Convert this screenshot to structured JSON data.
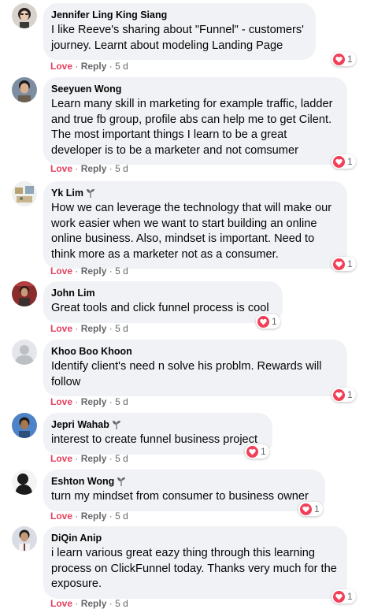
{
  "colors": {
    "love": "#e4405f",
    "bubble": "#f0f2f5",
    "meta": "#65676b"
  },
  "comments": [
    {
      "name": "Jennifer Ling King Siang",
      "text": "I like Reeve's sharing about \"Funnel\" - customers' journey. Learnt about modeling Landing Page",
      "love": "Love",
      "reply": "Reply",
      "time": "5 d",
      "reactions": "1"
    },
    {
      "name": "Seeyuen Wong",
      "text": "Learn many skill in marketing for example traffic, ladder and true fb group, profile abs can help me to get Cilent. The most important things I learn to be a great developer is to be a marketer and not comsumer",
      "love": "Love",
      "reply": "Reply",
      "time": "5 d",
      "reactions": "1"
    },
    {
      "name": "Yk Lim",
      "text": "How we can leverage the technology that will make our work easier when we want to start building an online online business. Also, mindset is important. Need to think more as a marketer not as a consumer.",
      "love": "Love",
      "reply": "Reply",
      "time": "5 d",
      "reactions": "1"
    },
    {
      "name": "John Lim",
      "text": "Great tools and click funnel process is cool",
      "love": "Love",
      "reply": "Reply",
      "time": "5 d",
      "reactions": "1"
    },
    {
      "name": "Khoo Boo Khoon",
      "text": "Identify client's need n solve his problm. Rewards will follow",
      "love": "Love",
      "reply": "Reply",
      "time": "5 d",
      "reactions": "1"
    },
    {
      "name": "Jepri Wahab",
      "text": "interest to create funnel business project",
      "love": "Love",
      "reply": "Reply",
      "time": "5 d",
      "reactions": "1"
    },
    {
      "name": "Eshton Wong",
      "text": "turn my mindset from consumer to business owner",
      "love": "Love",
      "reply": "Reply",
      "time": "5 d",
      "reactions": "1"
    },
    {
      "name": "DiQin Anip",
      "text": "i learn various great eazy thing through this learning process on ClickFunnel today. Thanks very much for the exposure.",
      "love": "Love",
      "reply": "Reply",
      "time": "5 d",
      "reactions": "1"
    }
  ]
}
